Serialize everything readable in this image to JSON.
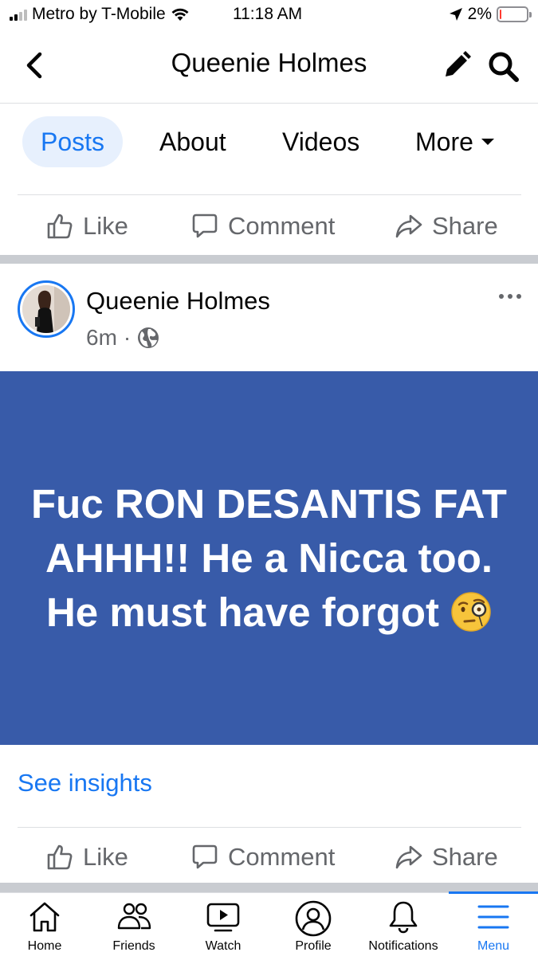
{
  "status_bar": {
    "carrier": "Metro by T-Mobile",
    "time": "11:18 AM",
    "battery_percent": "2%",
    "battery_level": 0.02,
    "signal_bars_on": 2,
    "signal_bars_total": 4,
    "icons": [
      "signal-icon",
      "wifi-icon",
      "location-arrow-icon",
      "battery-icon"
    ]
  },
  "header": {
    "title": "Queenie Holmes",
    "icons": [
      "back-chevron-icon",
      "edit-pencil-icon",
      "search-icon"
    ]
  },
  "tabs": [
    {
      "label": "Posts",
      "active": true
    },
    {
      "label": "About",
      "active": false
    },
    {
      "label": "Videos",
      "active": false
    },
    {
      "label": "More",
      "active": false
    }
  ],
  "actions": {
    "like": "Like",
    "comment": "Comment",
    "share": "Share"
  },
  "post": {
    "author": "Queenie Holmes",
    "time": "6m",
    "separator": "·",
    "privacy_icon": "globe-icon",
    "text": "Fuc RON DESANTIS FAT AHHH!! He a Nicca too. He must have forgot",
    "emoji": "face-with-monocle-emoji",
    "background_color": "#385ba9",
    "insights_link": "See insights"
  },
  "bottom_nav": [
    {
      "label": "Home",
      "icon": "home-icon",
      "active": false
    },
    {
      "label": "Friends",
      "icon": "friends-icon",
      "active": false
    },
    {
      "label": "Watch",
      "icon": "watch-icon",
      "active": false
    },
    {
      "label": "Profile",
      "icon": "profile-icon",
      "active": false
    },
    {
      "label": "Notifications",
      "icon": "bell-icon",
      "active": false
    },
    {
      "label": "Menu",
      "icon": "menu-icon",
      "active": true
    }
  ],
  "colors": {
    "accent": "#1877f2",
    "secondary_text": "#65676b",
    "divider": "#dddfe2",
    "section_separator": "#c9ccd1",
    "battery_low": "#ff3b30"
  }
}
